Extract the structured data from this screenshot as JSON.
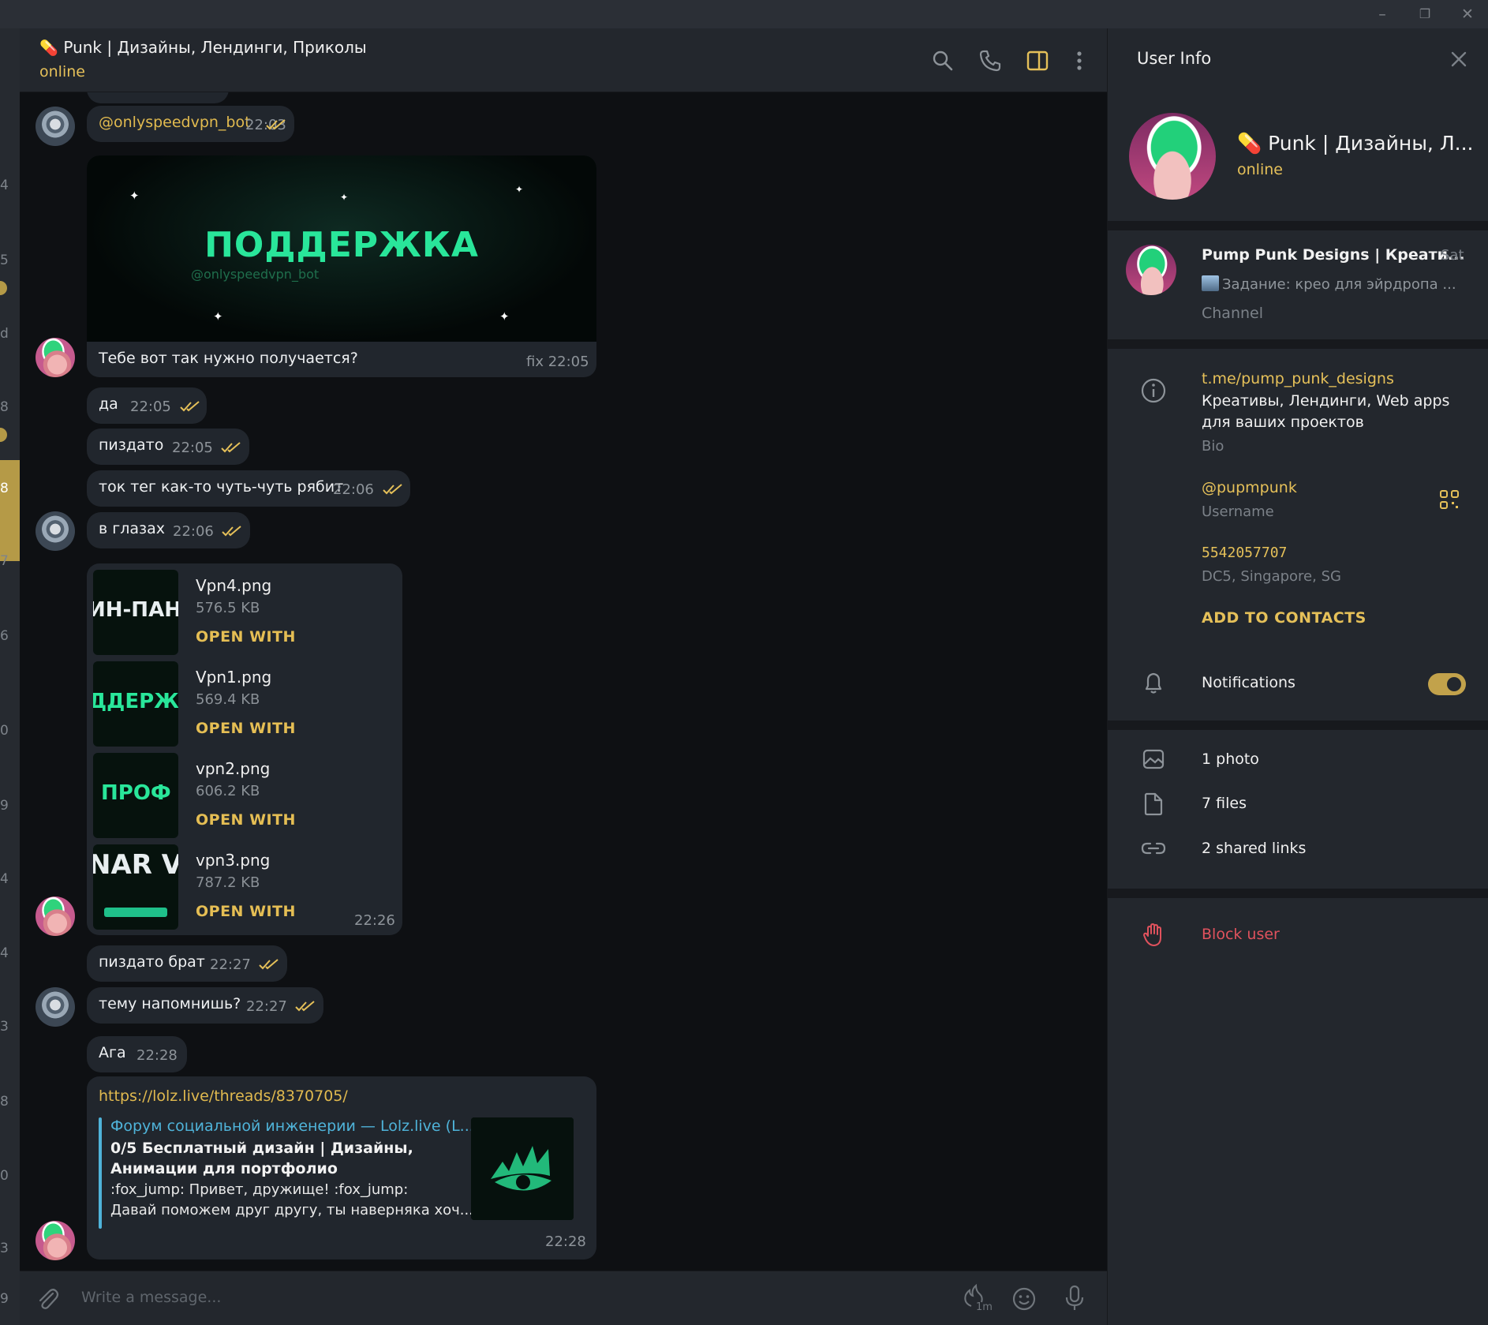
{
  "window": {
    "minimize": "–",
    "maximize": "❐",
    "close": "✕"
  },
  "sidebar": {
    "counters": [
      "4",
      "5",
      "d",
      "8",
      "8",
      "7",
      "6",
      "0",
      "9",
      "4",
      "4",
      "3",
      "8",
      "0",
      "3",
      "9"
    ]
  },
  "chat": {
    "title": "Punk | Дизайны, Лендинги, Приколы",
    "title_emoji": "💊",
    "status": "online",
    "icons": [
      "search-icon",
      "phone-icon",
      "sidebar-toggle-icon",
      "more-vertical-icon"
    ]
  },
  "messages": {
    "m0": {
      "text": "@onlyspeedvpn_bot",
      "time": "22:03"
    },
    "image": {
      "title": "ПОДДЕРЖКА",
      "subtitle": "@onlyspeedvpn_bot",
      "caption": "Тебе вот так нужно получается?",
      "meta": "fix 22:05"
    },
    "m1": {
      "text": "да",
      "time": "22:05"
    },
    "m2": {
      "text": "пиздато",
      "time": "22:05"
    },
    "m3": {
      "text": "ток тег как-то чуть-чуть рябит",
      "time": "22:06"
    },
    "m4": {
      "text": "в глазах",
      "time": "22:06"
    },
    "files": [
      {
        "name": "Vpn4.png",
        "size": "576.5 KB",
        "action": "OPEN WITH",
        "thumb": "ИН-ПАН"
      },
      {
        "name": "Vpn1.png",
        "size": "569.4 KB",
        "action": "OPEN WITH",
        "thumb": "ДДЕРЖ"
      },
      {
        "name": "vpn2.png",
        "size": "606.2 KB",
        "action": "OPEN WITH",
        "thumb": "ПРОФ"
      },
      {
        "name": "vpn3.png",
        "size": "787.2 KB",
        "action": "OPEN WITH",
        "thumb": "NAR V"
      }
    ],
    "files_time": "22:26",
    "m5": {
      "text": "пиздато брат",
      "time": "22:27"
    },
    "m6": {
      "text": "тему напомнишь?",
      "time": "22:27"
    },
    "m7": {
      "text": "Ага",
      "time": "22:28"
    },
    "link": {
      "url": "https://lolz.live/threads/8370705/",
      "site": "Форум социальной инженерии — Lolz.live (L...",
      "title_line1": "0/5 Бесплатный дизайн | Дизайны,",
      "title_line2": "Анимации для портфолио",
      "desc_line1": ":fox_jump: Привет, дружище! :fox_jump:",
      "desc_line2": "Давай поможем друг другу, ты наверняка хоч...",
      "time": "22:28"
    }
  },
  "composer": {
    "placeholder": "Write a message...",
    "timer_label": "1m"
  },
  "info": {
    "header": "User Info",
    "name": "Punk | Дизайны, Л...",
    "name_emoji": "💊",
    "status": "online",
    "channel": {
      "name": "Pump Punk Designs | Креати...",
      "date": "Sat",
      "last_message": "Задание: крео для эйрдропа ...",
      "type": "Channel"
    },
    "bio_link": "t.me/pump_punk_designs",
    "bio_line1": "Креативы, Лендинги, Web apps",
    "bio_line2": "для ваших проектов",
    "bio_label": "Bio",
    "username": "@pupmpunk",
    "username_label": "Username",
    "id": "5542057707",
    "dc": "DC5, Singapore, SG",
    "add_contacts": "ADD TO CONTACTS",
    "notifications": "Notifications",
    "notifications_on": true,
    "photos": "1 photo",
    "files": "7 files",
    "links": "2 shared links",
    "block": "Block user"
  },
  "colors": {
    "accent": "#e5c059",
    "link_blue": "#4fb3d9",
    "danger": "#e0525d",
    "bubble": "#21262d"
  }
}
